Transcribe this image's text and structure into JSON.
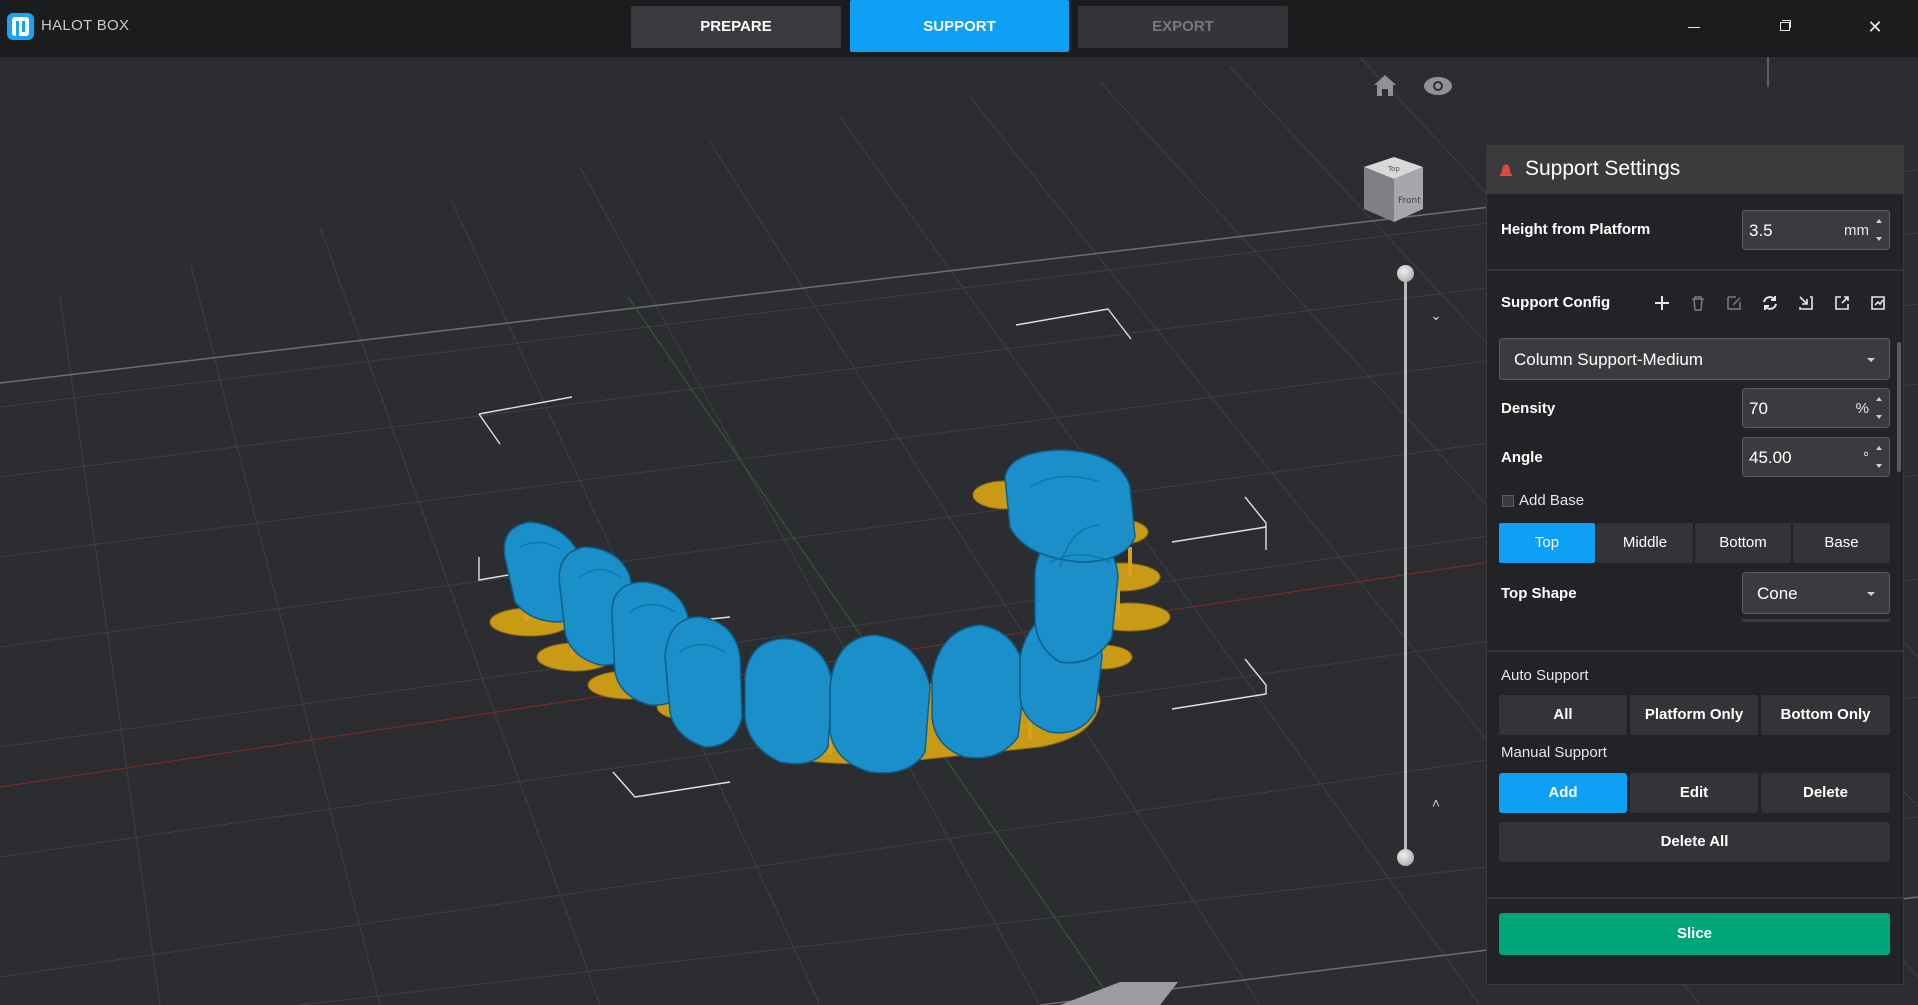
{
  "app": {
    "title": "HALOT BOX"
  },
  "tabs": {
    "prepare": "PREPARE",
    "support": "SUPPORT",
    "export": "EXPORT",
    "active": "SUPPORT"
  },
  "window": {
    "close_glyph": "✕"
  },
  "view_cube": {
    "top": "Top",
    "front": "Front"
  },
  "panel": {
    "title": "Support Settings",
    "height_from_platform": {
      "label": "Height from Platform",
      "value": "3.5",
      "unit": "mm"
    },
    "support_config": {
      "label": "Support Config",
      "tools": [
        "plus-icon",
        "trash-icon",
        "edit-icon",
        "refresh-icon",
        "import-icon",
        "export-icon",
        "save-icon"
      ],
      "selected": "Column Support-Medium"
    },
    "density": {
      "label": "Density",
      "value": "70",
      "unit": "%"
    },
    "angle": {
      "label": "Angle",
      "value": "45.00",
      "unit": "°"
    },
    "add_base": {
      "label": "Add Base",
      "checked": false
    },
    "position_tabs": [
      "Top",
      "Middle",
      "Bottom",
      "Base"
    ],
    "position_active": "Top",
    "top_shape": {
      "label": "Top Shape",
      "value": "Cone"
    },
    "auto_support": {
      "label": "Auto Support",
      "buttons": [
        "All",
        "Platform Only",
        "Bottom Only"
      ]
    },
    "manual_support": {
      "label": "Manual Support",
      "buttons": [
        "Add",
        "Edit",
        "Delete"
      ],
      "active": "Add",
      "delete_all": "Delete All"
    },
    "slice": "Slice"
  },
  "colors": {
    "accent": "#0ea0f5",
    "slice": "#00a67a",
    "model": "#1b8fc9",
    "support": "#d9a01c"
  }
}
